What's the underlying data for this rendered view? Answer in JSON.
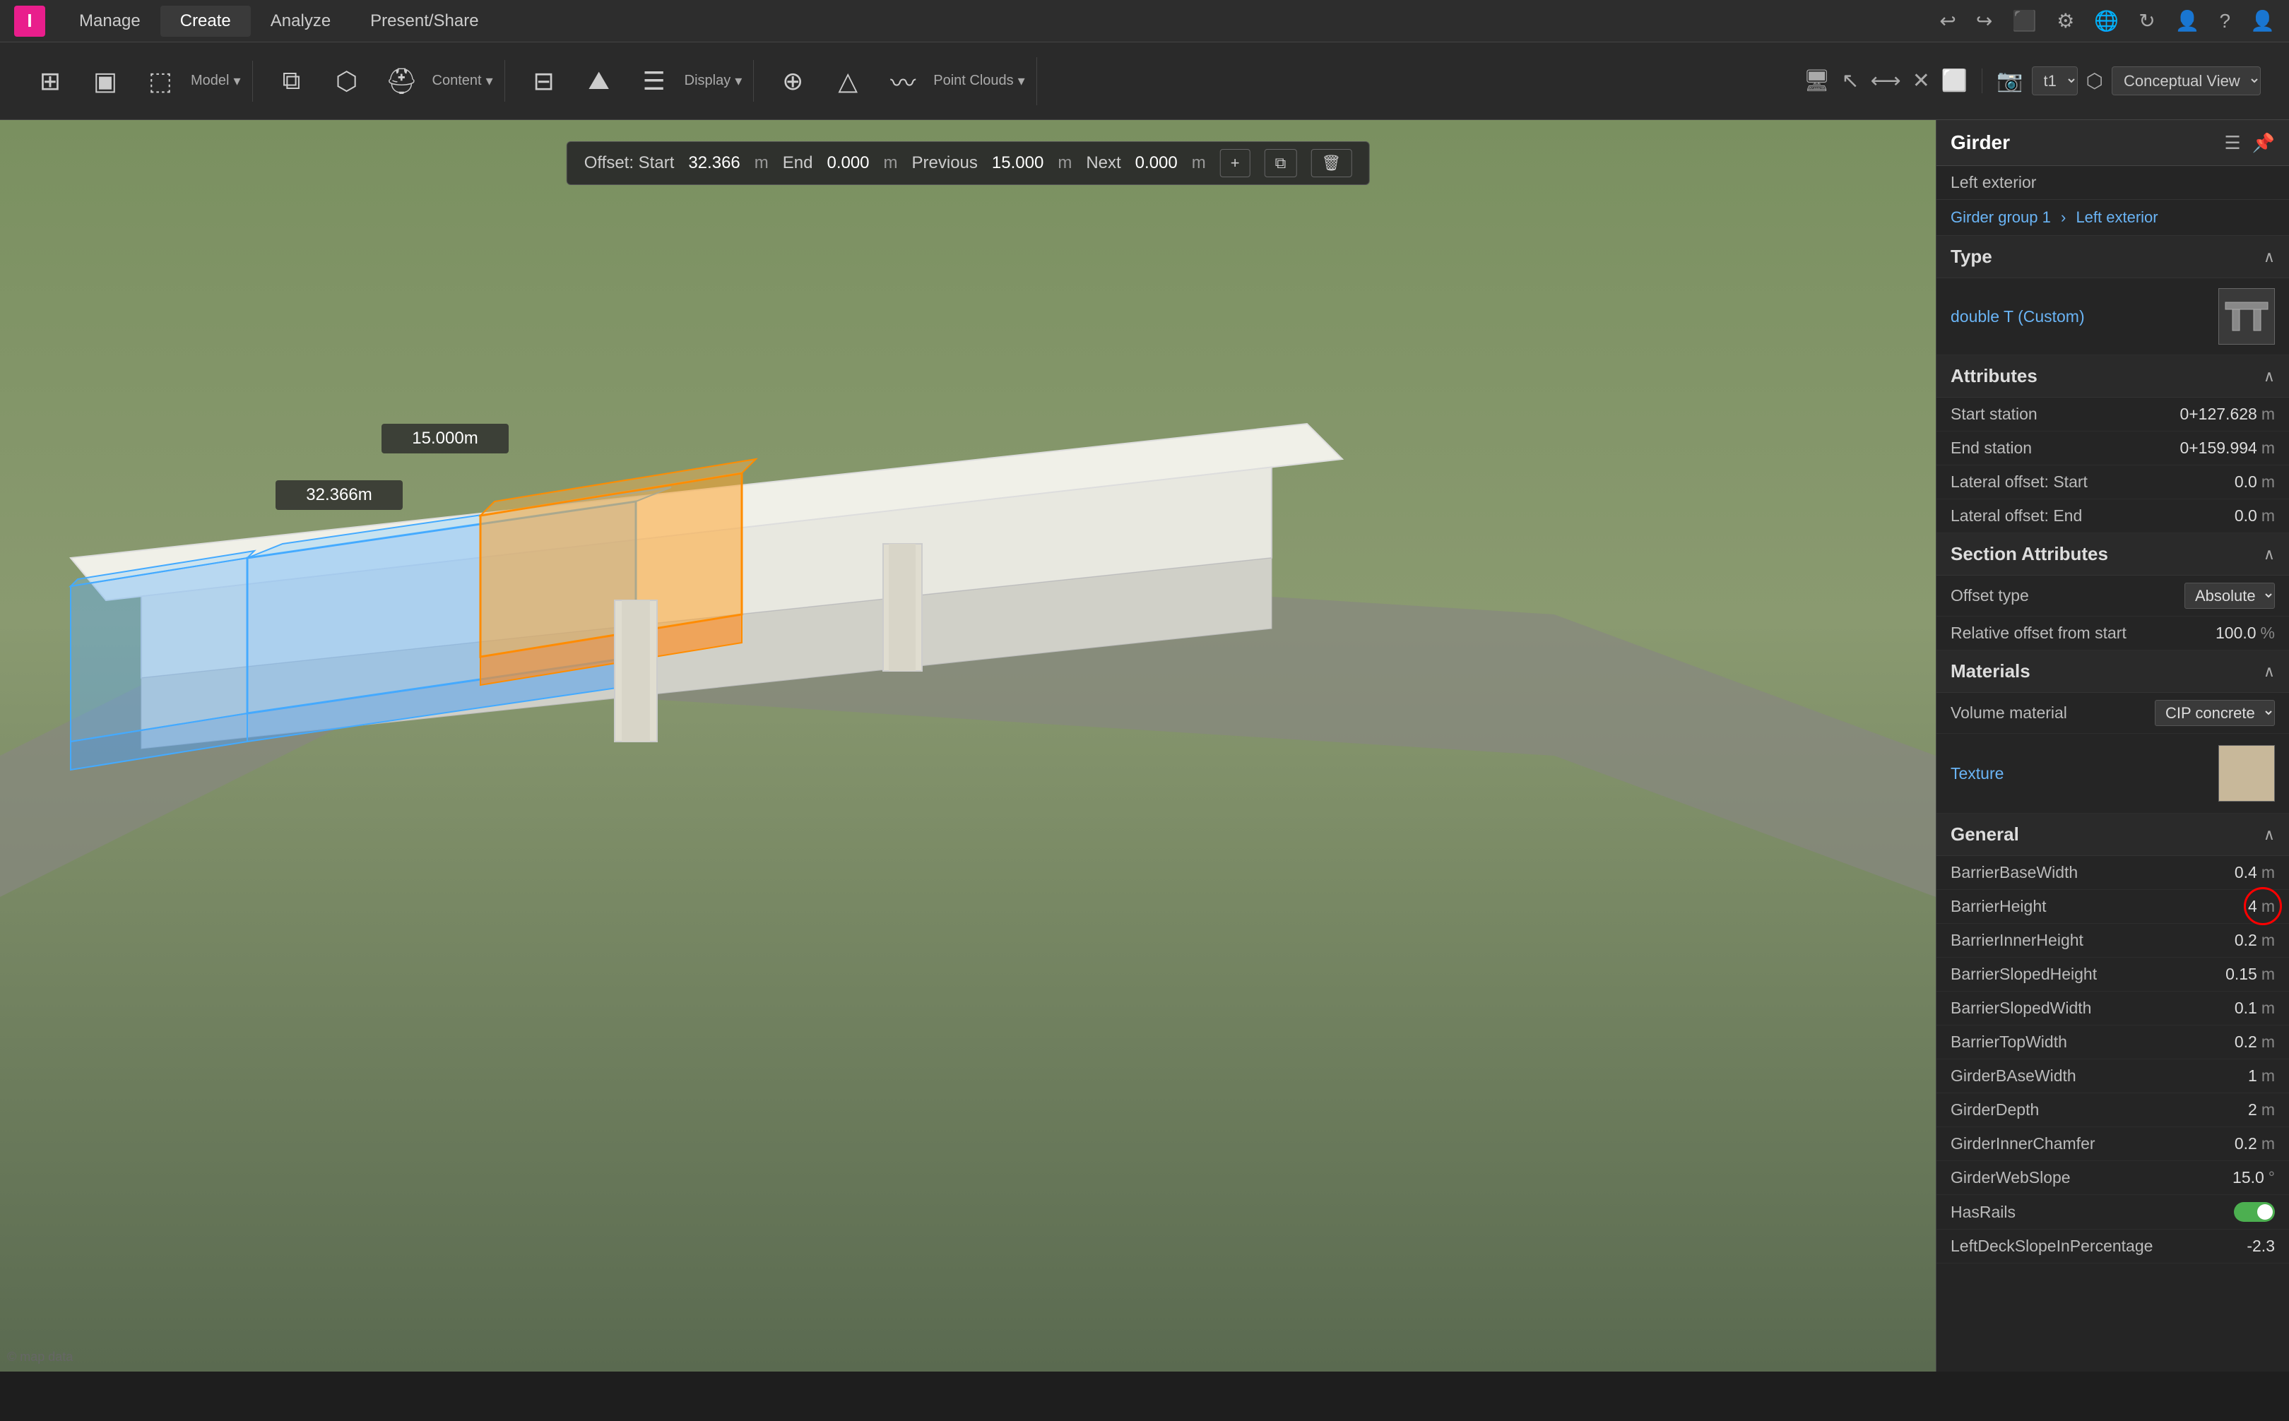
{
  "app": {
    "logo": "I",
    "menu_items": [
      "Manage",
      "Create",
      "Analyze",
      "Present/Share"
    ]
  },
  "toolbar": {
    "groups": [
      {
        "label": "Model",
        "items": [
          "grid-icon",
          "view-icon",
          "cursor-icon"
        ]
      },
      {
        "label": "Content",
        "items": [
          "layers-icon",
          "cube-icon",
          "helmet-icon"
        ]
      },
      {
        "label": "Display",
        "items": [
          "display-icon",
          "terrain-icon",
          "list-icon"
        ]
      },
      {
        "label": "Point Clouds",
        "items": [
          "points-icon",
          "mountain-icon",
          "brush-icon"
        ]
      }
    ]
  },
  "viewport": {
    "offset_bar": {
      "offset_label": "Offset: Start",
      "start_value": "32.366",
      "start_unit": "m",
      "end_label": "End",
      "end_value": "0.000",
      "end_unit": "m",
      "previous_label": "Previous",
      "previous_value": "15.000",
      "previous_unit": "m",
      "next_label": "Next",
      "next_value": "0.000",
      "next_unit": "m"
    }
  },
  "viewport_toolbar": {
    "view_label": "t1",
    "display_label": "Conceptual View"
  },
  "properties": {
    "title": "Girder",
    "subtitle": "Left exterior",
    "breadcrumb": {
      "group": "Girder group 1",
      "current": "Left exterior"
    },
    "type_section": {
      "label": "Type",
      "value": "double T (Custom)"
    },
    "attributes_section": {
      "label": "Attributes",
      "fields": [
        {
          "label": "Start station",
          "value": "0+127.628",
          "unit": "m"
        },
        {
          "label": "End station",
          "value": "0+159.994",
          "unit": "m"
        },
        {
          "label": "Lateral offset: Start",
          "value": "0.0",
          "unit": "m"
        },
        {
          "label": "Lateral offset: End",
          "value": "0.0",
          "unit": "m"
        }
      ]
    },
    "section_attributes": {
      "label": "Section Attributes",
      "fields": [
        {
          "label": "Offset type",
          "value": "Absolute",
          "is_dropdown": true
        },
        {
          "label": "Relative offset from start",
          "value": "100.0",
          "unit": "%"
        }
      ]
    },
    "materials_section": {
      "label": "Materials",
      "volume_material_label": "Volume material",
      "volume_material_value": "CIP concrete",
      "texture_label": "Texture"
    },
    "general_section": {
      "label": "General",
      "fields": [
        {
          "label": "BarrierBaseWidth",
          "value": "0.4",
          "unit": "m"
        },
        {
          "label": "BarrierHeight",
          "value": "4",
          "unit": "m",
          "has_annotation": true
        },
        {
          "label": "BarrierInnerHeight",
          "value": "0.2",
          "unit": "m"
        },
        {
          "label": "BarrierSlopedHeight",
          "value": "0.15",
          "unit": "m"
        },
        {
          "label": "BarrierSlopedWidth",
          "value": "0.1",
          "unit": "m"
        },
        {
          "label": "BarrierTopWidth",
          "value": "0.2",
          "unit": "m"
        },
        {
          "label": "GirderBAseWidth",
          "value": "1",
          "unit": "m"
        },
        {
          "label": "GirderDepth",
          "value": "2",
          "unit": "m"
        },
        {
          "label": "GirderInnerChamfer",
          "value": "0.2",
          "unit": "m"
        },
        {
          "label": "GirderWebSlope",
          "value": "15.0",
          "unit": "°"
        },
        {
          "label": "HasRails",
          "value": "toggle_on"
        },
        {
          "label": "LeftDeckSlopeInPercentage",
          "value": "-2.3"
        }
      ]
    }
  }
}
